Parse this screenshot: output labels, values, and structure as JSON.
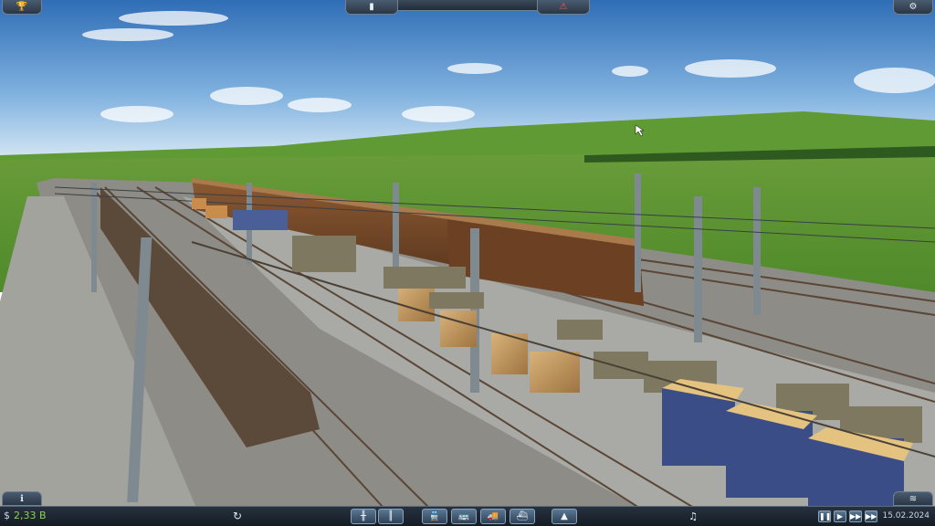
{
  "hud": {
    "money": "2,33 B",
    "currency_symbol": "$",
    "date": "15.02.2024"
  },
  "icons": {
    "trophy": "trophy-icon",
    "news": "news-icon",
    "alert": "alert-icon",
    "settings": "gear-icon",
    "info": "info-icon",
    "layers": "layers-icon",
    "bulldoze": "bulldoze-icon",
    "rail": "rail-icon",
    "road": "road-icon",
    "train": "train-icon",
    "bus": "bus-icon",
    "truck": "truck-icon",
    "ship": "ship-icon",
    "terrain": "terrain-icon",
    "sound": "sound-icon"
  },
  "colors": {
    "money": "#8fd14f",
    "hud_bg": "#1c2530",
    "accent": "#5b7893"
  }
}
